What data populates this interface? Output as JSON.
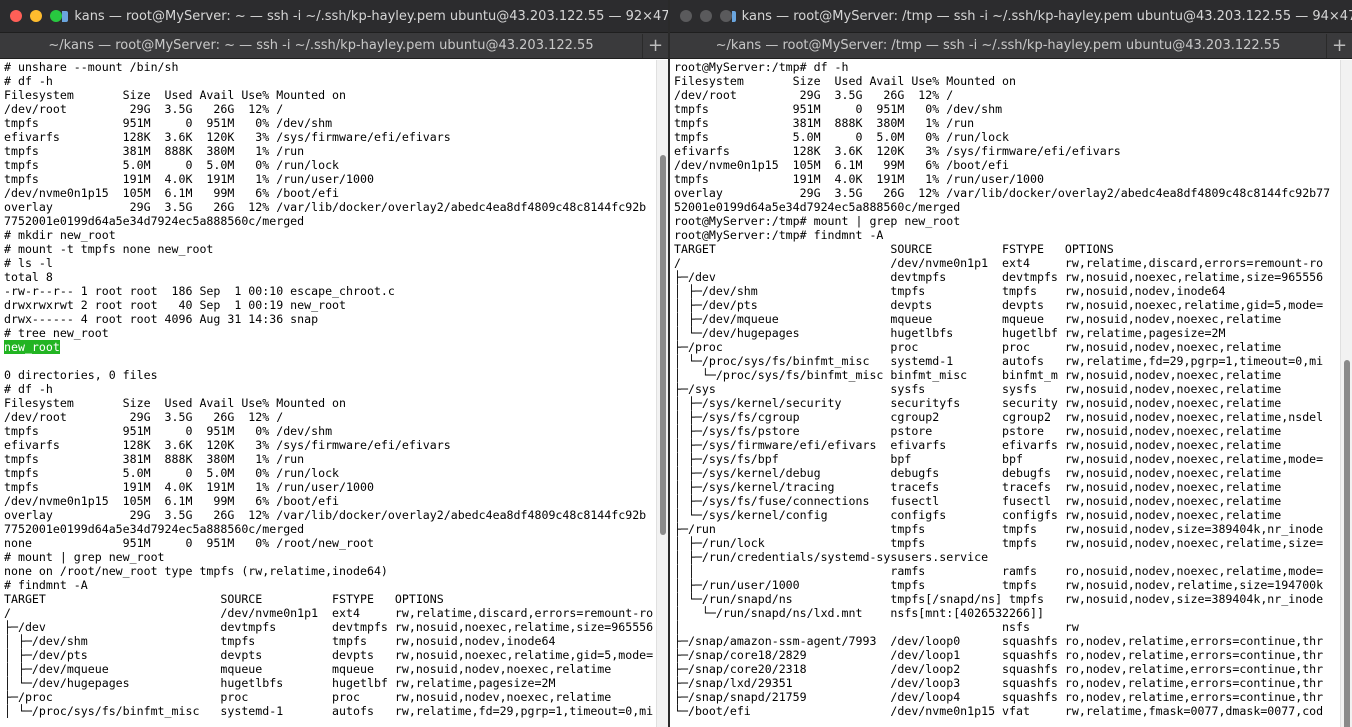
{
  "colors": {
    "close": "#ff5f57",
    "minimize": "#febc2e",
    "maximize": "#28c840",
    "inactive": "#5a5a5c",
    "highlight": "#22b422"
  },
  "left": {
    "title": "kans — root@MyServer: ~ — ssh -i ~/.ssh/kp-hayley.pem ubuntu@43.203.122.55 — 92×47",
    "tab": "~/kans — root@MyServer: ~ — ssh -i ~/.ssh/kp-hayley.pem ubuntu@43.203.122.55",
    "new_tab": "+",
    "lines": [
      "# unshare --mount /bin/sh",
      "# df -h",
      "Filesystem       Size  Used Avail Use% Mounted on",
      "/dev/root         29G  3.5G   26G  12% /",
      "tmpfs            951M     0  951M   0% /dev/shm",
      "efivarfs         128K  3.6K  120K   3% /sys/firmware/efi/efivars",
      "tmpfs            381M  888K  380M   1% /run",
      "tmpfs            5.0M     0  5.0M   0% /run/lock",
      "tmpfs            191M  4.0K  191M   1% /run/user/1000",
      "/dev/nvme0n1p15  105M  6.1M   99M   6% /boot/efi",
      "overlay           29G  3.5G   26G  12% /var/lib/docker/overlay2/abedc4ea8df4809c48c8144fc92b",
      "7752001e0199d64a5e34d7924ec5a888560c/merged",
      "# mkdir new_root",
      "# mount -t tmpfs none new_root",
      "# ls -l",
      "total 8",
      "-rw-r--r-- 1 root root  186 Sep  1 00:10 escape_chroot.c",
      "drwxrwxrwt 2 root root   40 Sep  1 00:19 new_root",
      "drwx------ 4 root root 4096 Aug 31 14:36 snap",
      "# tree new_root",
      "new_root",
      "",
      "0 directories, 0 files",
      "# df -h",
      "Filesystem       Size  Used Avail Use% Mounted on",
      "/dev/root         29G  3.5G   26G  12% /",
      "tmpfs            951M     0  951M   0% /dev/shm",
      "efivarfs         128K  3.6K  120K   3% /sys/firmware/efi/efivars",
      "tmpfs            381M  888K  380M   1% /run",
      "tmpfs            5.0M     0  5.0M   0% /run/lock",
      "tmpfs            191M  4.0K  191M   1% /run/user/1000",
      "/dev/nvme0n1p15  105M  6.1M   99M   6% /boot/efi",
      "overlay           29G  3.5G   26G  12% /var/lib/docker/overlay2/abedc4ea8df4809c48c8144fc92b",
      "7752001e0199d64a5e34d7924ec5a888560c/merged",
      "none             951M     0  951M   0% /root/new_root",
      "# mount | grep new_root",
      "none on /root/new_root type tmpfs (rw,relatime,inode64)",
      "# findmnt -A",
      "TARGET                         SOURCE          FSTYPE   OPTIONS",
      "/                              /dev/nvme0n1p1  ext4     rw,relatime,discard,errors=remount-ro",
      "├─/dev                         devtmpfs        devtmpfs rw,nosuid,noexec,relatime,size=965556",
      "│ ├─/dev/shm                   tmpfs           tmpfs    rw,nosuid,nodev,inode64",
      "│ ├─/dev/pts                   devpts          devpts   rw,nosuid,noexec,relatime,gid=5,mode=",
      "│ ├─/dev/mqueue                mqueue          mqueue   rw,nosuid,nodev,noexec,relatime",
      "│ └─/dev/hugepages             hugetlbfs       hugetlbf rw,relatime,pagesize=2M",
      "├─/proc                        proc            proc     rw,nosuid,nodev,noexec,relatime",
      "│ └─/proc/sys/fs/binfmt_misc   systemd-1       autofs   rw,relatime,fd=29,pgrp=1,timeout=0,mi"
    ]
  },
  "right": {
    "title": "kans — root@MyServer: /tmp — ssh -i ~/.ssh/kp-hayley.pem ubuntu@43.203.122.55 — 94×47",
    "tab": "~/kans — root@MyServer: /tmp — ssh -i ~/.ssh/kp-hayley.pem ubuntu@43.203.122.55",
    "new_tab": "+",
    "lines": [
      "root@MyServer:/tmp# df -h",
      "Filesystem       Size  Used Avail Use% Mounted on",
      "/dev/root         29G  3.5G   26G  12% /",
      "tmpfs            951M     0  951M   0% /dev/shm",
      "tmpfs            381M  888K  380M   1% /run",
      "tmpfs            5.0M     0  5.0M   0% /run/lock",
      "efivarfs         128K  3.6K  120K   3% /sys/firmware/efi/efivars",
      "/dev/nvme0n1p15  105M  6.1M   99M   6% /boot/efi",
      "tmpfs            191M  4.0K  191M   1% /run/user/1000",
      "overlay           29G  3.5G   26G  12% /var/lib/docker/overlay2/abedc4ea8df4809c48c8144fc92b77",
      "52001e0199d64a5e34d7924ec5a888560c/merged",
      "root@MyServer:/tmp# mount | grep new_root",
      "root@MyServer:/tmp# findmnt -A",
      "TARGET                         SOURCE          FSTYPE   OPTIONS",
      "/                              /dev/nvme0n1p1  ext4     rw,relatime,discard,errors=remount-ro",
      "├─/dev                         devtmpfs        devtmpfs rw,nosuid,noexec,relatime,size=965556",
      "│ ├─/dev/shm                   tmpfs           tmpfs    rw,nosuid,nodev,inode64",
      "│ ├─/dev/pts                   devpts          devpts   rw,nosuid,noexec,relatime,gid=5,mode=",
      "│ ├─/dev/mqueue                mqueue          mqueue   rw,nosuid,nodev,noexec,relatime",
      "│ └─/dev/hugepages             hugetlbfs       hugetlbf rw,relatime,pagesize=2M",
      "├─/proc                        proc            proc     rw,nosuid,nodev,noexec,relatime",
      "│ └─/proc/sys/fs/binfmt_misc   systemd-1       autofs   rw,relatime,fd=29,pgrp=1,timeout=0,mi",
      "│   └─/proc/sys/fs/binfmt_misc binfmt_misc     binfmt_m rw,nosuid,nodev,noexec,relatime",
      "├─/sys                         sysfs           sysfs    rw,nosuid,nodev,noexec,relatime",
      "│ ├─/sys/kernel/security       securityfs      security rw,nosuid,nodev,noexec,relatime",
      "│ ├─/sys/fs/cgroup             cgroup2         cgroup2  rw,nosuid,nodev,noexec,relatime,nsdel",
      "│ ├─/sys/fs/pstore             pstore          pstore   rw,nosuid,nodev,noexec,relatime",
      "│ ├─/sys/firmware/efi/efivars  efivarfs        efivarfs rw,nosuid,nodev,noexec,relatime",
      "│ ├─/sys/fs/bpf                bpf             bpf      rw,nosuid,nodev,noexec,relatime,mode=",
      "│ ├─/sys/kernel/debug          debugfs         debugfs  rw,nosuid,nodev,noexec,relatime",
      "│ ├─/sys/kernel/tracing        tracefs         tracefs  rw,nosuid,nodev,noexec,relatime",
      "│ ├─/sys/fs/fuse/connections   fusectl         fusectl  rw,nosuid,nodev,noexec,relatime",
      "│ └─/sys/kernel/config         configfs        configfs rw,nosuid,nodev,noexec,relatime",
      "├─/run                         tmpfs           tmpfs    rw,nosuid,nodev,size=389404k,nr_inode",
      "│ ├─/run/lock                  tmpfs           tmpfs    rw,nosuid,nodev,noexec,relatime,size=",
      "│ ├─/run/credentials/systemd-sysusers.service",
      "│ │                            ramfs           ramfs    ro,nosuid,nodev,noexec,relatime,mode=",
      "│ ├─/run/user/1000             tmpfs           tmpfs    rw,nosuid,nodev,relatime,size=194700k",
      "│ └─/run/snapd/ns              tmpfs[/snapd/ns] tmpfs   rw,nosuid,nodev,size=389404k,nr_inode",
      "│   └─/run/snapd/ns/lxd.mnt    nsfs[mnt:[4026532266]]",
      "│                                              nsfs     rw",
      "├─/snap/amazon-ssm-agent/7993  /dev/loop0      squashfs ro,nodev,relatime,errors=continue,thr",
      "├─/snap/core18/2829            /dev/loop1      squashfs ro,nodev,relatime,errors=continue,thr",
      "├─/snap/core20/2318            /dev/loop2      squashfs ro,nodev,relatime,errors=continue,thr",
      "├─/snap/lxd/29351              /dev/loop3      squashfs ro,nodev,relatime,errors=continue,thr",
      "├─/snap/snapd/21759            /dev/loop4      squashfs ro,nodev,relatime,errors=continue,thr",
      "└─/boot/efi                    /dev/nvme0n1p15 vfat     rw,relatime,fmask=0077,dmask=0077,cod"
    ]
  }
}
